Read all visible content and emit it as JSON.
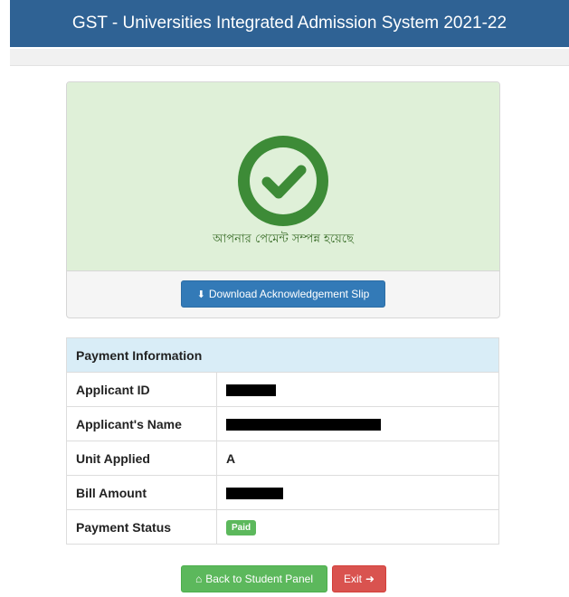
{
  "header": {
    "title": "GST - Universities Integrated Admission System 2021-22"
  },
  "success": {
    "icon": "check-circle-icon",
    "message": "আপনার পেমেন্ট সম্পন্ন হয়েছে",
    "download_icon": "download-icon",
    "download_label": "Download Acknowledgement Slip"
  },
  "payment_info": {
    "heading": "Payment Information",
    "rows": [
      {
        "label": "Applicant ID",
        "value": ""
      },
      {
        "label": "Applicant's Name",
        "value": ""
      },
      {
        "label": "Unit Applied",
        "value": "A"
      },
      {
        "label": "Bill Amount",
        "value": ""
      },
      {
        "label": "Payment Status",
        "value": "Paid"
      }
    ]
  },
  "actions": {
    "back_icon": "home-icon",
    "back_label": "Back to Student Panel",
    "exit_label": "Exit",
    "exit_icon": "sign-out-icon"
  },
  "colors": {
    "header_bg": "#2f6294",
    "success_bg": "#dff0d8",
    "check_green": "#3d8b37",
    "primary": "#337ab7",
    "success_btn": "#5cb85c",
    "danger_btn": "#d9534f",
    "table_head_bg": "#d9edf7"
  }
}
